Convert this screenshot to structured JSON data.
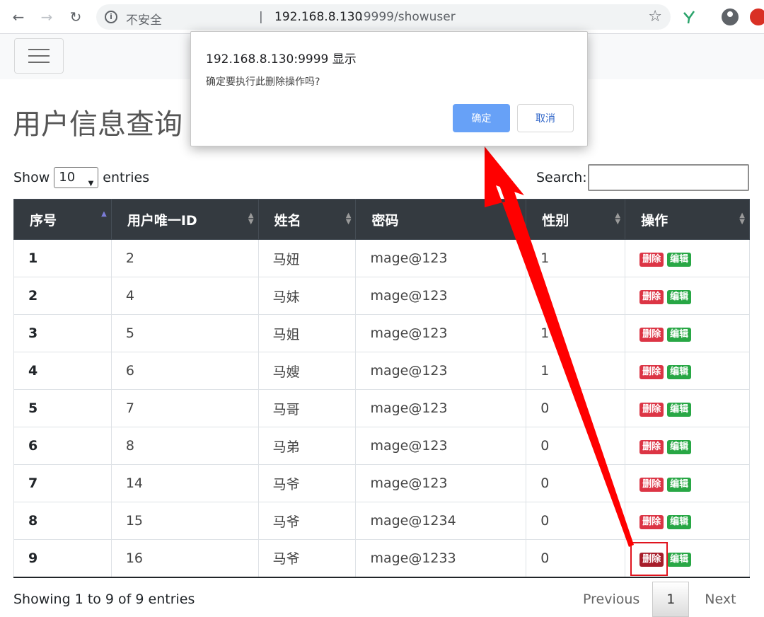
{
  "browser": {
    "insecure_label": "不安全",
    "separator": "|",
    "url_host": "192.168.8.130",
    "url_path": ":9999/showuser"
  },
  "page": {
    "title": "用户信息查询",
    "show_label": "Show",
    "entries_label": "entries",
    "page_length": "10",
    "search_label": "Search:",
    "search_value": ""
  },
  "table": {
    "headers": [
      "序号",
      "用户唯一ID",
      "姓名",
      "密码",
      "性别",
      "操作"
    ],
    "rows": [
      {
        "idx": "1",
        "uid": "2",
        "name": "马妞",
        "pwd": "mage@123",
        "gender": "1"
      },
      {
        "idx": "2",
        "uid": "4",
        "name": "马妹",
        "pwd": "mage@123",
        "gender": ""
      },
      {
        "idx": "3",
        "uid": "5",
        "name": "马姐",
        "pwd": "mage@123",
        "gender": "1"
      },
      {
        "idx": "4",
        "uid": "6",
        "name": "马嫂",
        "pwd": "mage@123",
        "gender": "1"
      },
      {
        "idx": "5",
        "uid": "7",
        "name": "马哥",
        "pwd": "mage@123",
        "gender": "0"
      },
      {
        "idx": "6",
        "uid": "8",
        "name": "马弟",
        "pwd": "mage@123",
        "gender": "0"
      },
      {
        "idx": "7",
        "uid": "14",
        "name": "马爷",
        "pwd": "mage@123",
        "gender": "0"
      },
      {
        "idx": "8",
        "uid": "15",
        "name": "马爷",
        "pwd": "mage@1234",
        "gender": "0"
      },
      {
        "idx": "9",
        "uid": "16",
        "name": "马爷",
        "pwd": "mage@1233",
        "gender": "0"
      }
    ],
    "delete_label": "删除",
    "edit_label": "编辑"
  },
  "footer": {
    "info": "Showing 1 to 9 of 9 entries",
    "previous": "Previous",
    "current_page": "1",
    "next": "Next"
  },
  "dialog": {
    "title": "192.168.8.130:9999 显示",
    "message": "确定要执行此删除操作吗?",
    "ok_label": "确定",
    "cancel_label": "取消"
  },
  "colors": {
    "header_bg": "#343a40",
    "delete_badge": "#dc3545",
    "edit_badge": "#28a745",
    "ok_button": "#67a1f7",
    "annotation_red": "#ff0000"
  }
}
